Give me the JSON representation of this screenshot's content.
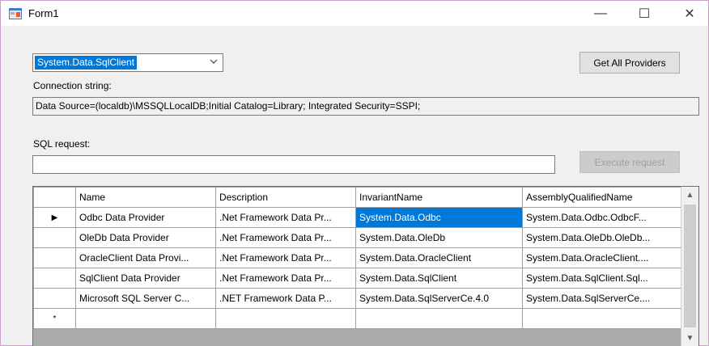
{
  "window": {
    "title": "Form1",
    "minimize_glyph": "—",
    "maximize_glyph": "☐",
    "close_glyph": "✕"
  },
  "provider_combo": {
    "selected": "System.Data.SqlClient"
  },
  "buttons": {
    "get_all_providers": "Get All Providers",
    "execute_request": "Execute request"
  },
  "connection": {
    "label": "Connection string:",
    "value": "Data Source=(localdb)\\MSSQLLocalDB;Initial Catalog=Library; Integrated Security=SSPI;"
  },
  "sql": {
    "label": "SQL request:",
    "value": ""
  },
  "grid": {
    "columns": [
      "Name",
      "Description",
      "InvariantName",
      "AssemblyQualifiedName"
    ],
    "rows": [
      {
        "marker": "▶",
        "cells": [
          "Odbc Data Provider",
          ".Net Framework Data Pr...",
          "System.Data.Odbc",
          "System.Data.Odbc.OdbcF..."
        ]
      },
      {
        "marker": "",
        "cells": [
          "OleDb Data Provider",
          ".Net Framework Data Pr...",
          "System.Data.OleDb",
          "System.Data.OleDb.OleDb..."
        ]
      },
      {
        "marker": "",
        "cells": [
          "OracleClient Data Provi...",
          ".Net Framework Data Pr...",
          "System.Data.OracleClient",
          "System.Data.OracleClient...."
        ]
      },
      {
        "marker": "",
        "cells": [
          "SqlClient Data Provider",
          ".Net Framework Data Pr...",
          "System.Data.SqlClient",
          "System.Data.SqlClient.Sql..."
        ]
      },
      {
        "marker": "",
        "cells": [
          "Microsoft SQL Server C...",
          ".NET Framework Data P...",
          "System.Data.SqlServerCe.4.0",
          "System.Data.SqlServerCe...."
        ]
      },
      {
        "marker": "*",
        "cells": [
          "",
          "",
          "",
          ""
        ]
      }
    ],
    "selected_cell": {
      "row": 0,
      "col": 2
    }
  },
  "colors": {
    "selection": "#0078d7",
    "window_bg": "#f0f0f0"
  },
  "icons": {
    "app": "form-app-icon",
    "combo_arrow": "chevron-down-icon",
    "scroll_up": "scroll-up-icon",
    "scroll_down": "scroll-down-icon"
  }
}
